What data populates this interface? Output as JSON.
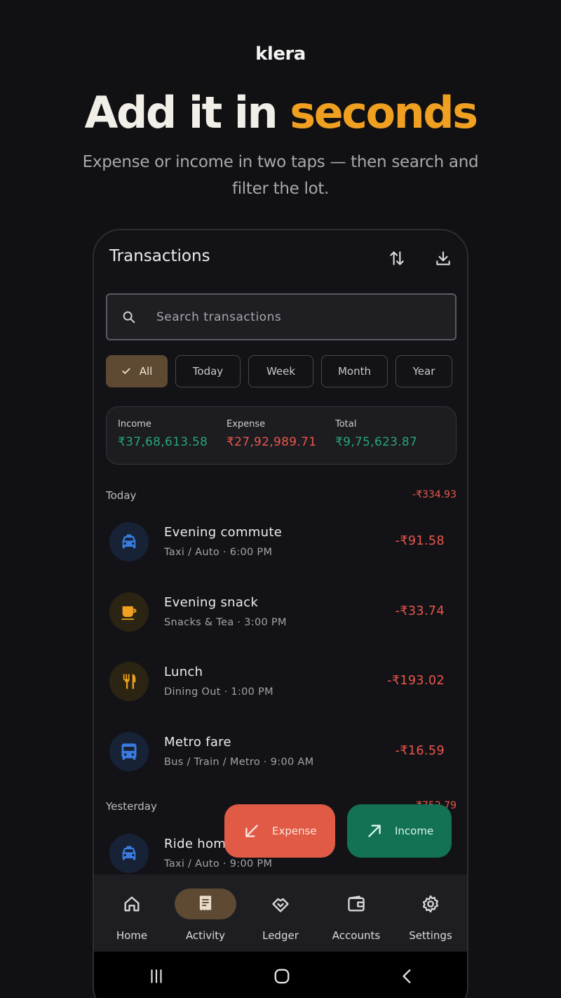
{
  "promo": {
    "brand": "klera",
    "headline_main": "Add it in ",
    "headline_accent": "seconds",
    "subtitle": "Expense or income in two taps — then search and filter the lot."
  },
  "colors": {
    "accent": "#f0a020",
    "income": "#27a57c",
    "expense": "#e9574a",
    "active_chip": "#5e4932"
  },
  "app": {
    "title": "Transactions",
    "header_icons": [
      "sort-icon",
      "download-icon"
    ],
    "search": {
      "placeholder": "Search transactions",
      "value": ""
    },
    "filters": [
      "All",
      "Today",
      "Week",
      "Month",
      "Year"
    ],
    "active_filter": "All",
    "summary": [
      {
        "label": "Income",
        "value": "₹37,68,613.58"
      },
      {
        "label": "Expense",
        "value": "₹27,92,989.71"
      },
      {
        "label": "Total",
        "value": "₹9,75,623.87"
      }
    ],
    "sections": [
      {
        "label": "Today",
        "total": "-₹334.93",
        "items": [
          {
            "icon": "taxi-icon",
            "title": "Evening commute",
            "subtitle": "Taxi / Auto · 6:00 PM",
            "amount": "-₹91.58"
          },
          {
            "icon": "coffee-icon",
            "title": "Evening snack",
            "subtitle": "Snacks & Tea · 3:00 PM",
            "amount": "-₹33.74"
          },
          {
            "icon": "restaurant-icon",
            "title": "Lunch",
            "subtitle": "Dining Out · 1:00 PM",
            "amount": "-₹193.02"
          },
          {
            "icon": "bus-icon",
            "title": "Metro fare",
            "subtitle": "Bus / Train / Metro · 9:00 AM",
            "amount": "-₹16.59"
          }
        ]
      },
      {
        "label": "Yesterday",
        "total": "-₹752.79",
        "items": [
          {
            "icon": "taxi-icon",
            "title": "Ride home",
            "subtitle": "Taxi / Auto · 9:00 PM",
            "amount": ""
          }
        ]
      }
    ],
    "fabs": {
      "expense": "Expense",
      "income": "Income"
    },
    "nav": [
      {
        "label": "Home",
        "icon": "home-icon"
      },
      {
        "label": "Activity",
        "icon": "receipt-icon"
      },
      {
        "label": "Ledger",
        "icon": "handshake-icon"
      },
      {
        "label": "Accounts",
        "icon": "wallet-icon"
      },
      {
        "label": "Settings",
        "icon": "gear-icon"
      }
    ],
    "active_nav": "Activity"
  }
}
